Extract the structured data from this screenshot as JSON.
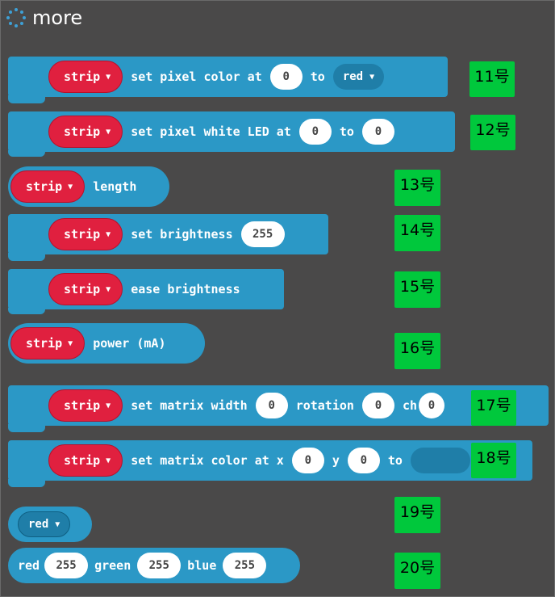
{
  "header": {
    "title": "more"
  },
  "blocks": {
    "b11": {
      "strip": "strip",
      "text1": "set pixel color at",
      "v1": "0",
      "text2": "to",
      "color": "red"
    },
    "b12": {
      "strip": "strip",
      "text1": "set pixel white LED at",
      "v1": "0",
      "text2": "to",
      "v2": "0"
    },
    "b13": {
      "strip": "strip",
      "text1": "length"
    },
    "b14": {
      "strip": "strip",
      "text1": "set brightness",
      "v1": "255"
    },
    "b15": {
      "strip": "strip",
      "text1": "ease brightness"
    },
    "b16": {
      "strip": "strip",
      "text1": "power (mA)"
    },
    "b17": {
      "strip": "strip",
      "text1": "set matrix width",
      "v1": "0",
      "text2": "rotation",
      "v2": "0",
      "text3": "ch",
      "v3": "0"
    },
    "b18": {
      "strip": "strip",
      "text1": "set matrix color at x",
      "v1": "0",
      "text2": "y",
      "v2": "0",
      "text3": "to"
    },
    "b19": {
      "color": "red"
    },
    "b20": {
      "l1": "red",
      "v1": "255",
      "l2": "green",
      "v2": "255",
      "l3": "blue",
      "v3": "255"
    }
  },
  "tags": [
    "11号",
    "12号",
    "13号",
    "14号",
    "15号",
    "16号",
    "17号",
    "18号",
    "19号",
    "20号"
  ],
  "colors": {
    "background": "#4a4949",
    "block": "#2b98c6",
    "strip": "#e0203f",
    "tag": "#00c83c"
  }
}
